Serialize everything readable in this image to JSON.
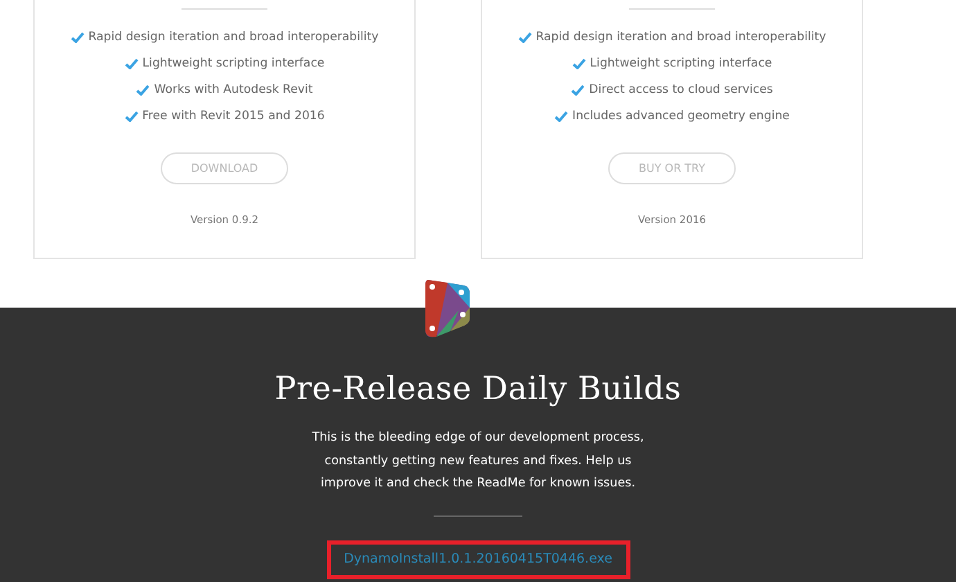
{
  "cards": [
    {
      "features": [
        "Rapid design iteration and broad interoperability",
        "Lightweight scripting interface",
        "Works with Autodesk Revit",
        "Free with Revit 2015 and 2016"
      ],
      "button": {
        "label": "DOWNLOAD",
        "disabled": true
      },
      "version": "Version 0.9.2"
    },
    {
      "features": [
        "Rapid design iteration and broad interoperability",
        "Lightweight scripting interface",
        "Direct access to cloud services",
        "Includes advanced geometry engine"
      ],
      "button": {
        "label": "BUY OR TRY",
        "disabled": true
      },
      "version": "Version 2016"
    }
  ],
  "prerelease": {
    "title": "Pre-Release Daily Builds",
    "description": "This is the bleeding edge of our development process, constantly getting new features and fixes. Help us improve it and check the ReadMe for known issues.",
    "download_link": {
      "label": "DynamoInstall1.0.1.20160415T0446.exe",
      "highlighted": true
    }
  }
}
